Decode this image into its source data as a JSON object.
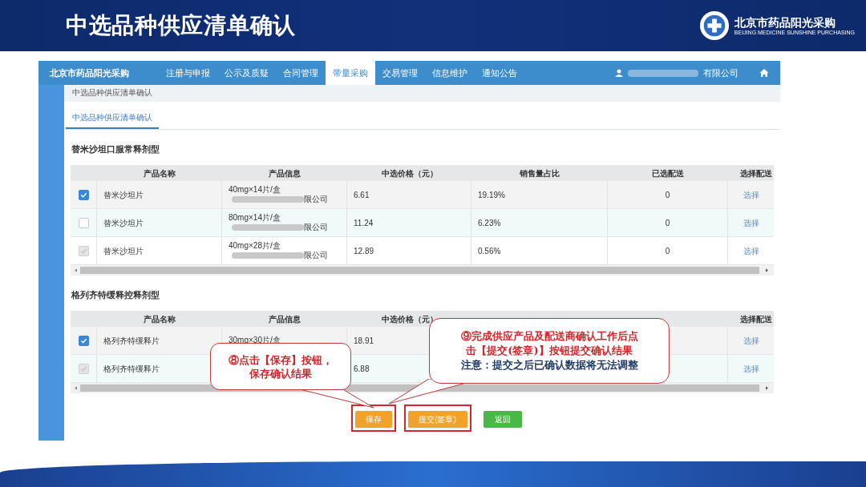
{
  "slide_title": "中选品种供应清单确认",
  "logo": {
    "name": "北京市药品阳光采购",
    "subtitle": "BEIJING MEDICINE SUNSHINE PURCHASING"
  },
  "app": {
    "brand": "北京市药品阳光采购",
    "nav": [
      {
        "label": "注册与申报",
        "selected": false
      },
      {
        "label": "公示及质疑",
        "selected": false
      },
      {
        "label": "合同管理",
        "selected": false
      },
      {
        "label": "带量采购",
        "selected": true
      },
      {
        "label": "交易管理",
        "selected": false
      },
      {
        "label": "信息维护",
        "selected": false
      },
      {
        "label": "通知公告",
        "selected": false
      }
    ],
    "user": "有限公司",
    "breadcrumb": "中选品种供应清单确认",
    "tabs": [
      {
        "label": "中选品种供应清单确认",
        "selected": true
      }
    ]
  },
  "sections": [
    {
      "title": "替米沙坦口服常释剂型",
      "headers": {
        "name": "产品名称",
        "info": "产品信息",
        "price": "中选价格（元）",
        "share": "销售量占比",
        "chosen": "已选配送",
        "select": "选择配送"
      },
      "rows": [
        {
          "checked": true,
          "disabled": false,
          "name": "替米沙坦片",
          "spec": "40mg×14片/盒",
          "company": "限公司",
          "price": "6.61",
          "share": "19.19%",
          "chosen": "0",
          "select": "选择"
        },
        {
          "checked": false,
          "disabled": false,
          "name": "替米沙坦片",
          "spec": "80mg×14片/盒",
          "company": "限公司",
          "price": "11.24",
          "share": "6.23%",
          "chosen": "0",
          "select": "选择"
        },
        {
          "checked": true,
          "disabled": true,
          "name": "替米沙坦片",
          "spec": "40mg×28片/盒",
          "company": "限公司",
          "price": "12.89",
          "share": "0.56%",
          "chosen": "0",
          "select": "选择"
        }
      ]
    },
    {
      "title": "格列齐特缓释控释剂型",
      "headers": {
        "name": "产品名称",
        "info": "产品信息",
        "price": "中选价格（元）",
        "select": "选择配送"
      },
      "rows": [
        {
          "checked": true,
          "disabled": false,
          "name": "格列齐特缓释片",
          "spec": "30mg×30片/盒",
          "price": "18.91",
          "select": "选择"
        },
        {
          "checked": true,
          "disabled": true,
          "name": "格列齐特缓释片",
          "price": "6.88",
          "select": "选择"
        }
      ]
    }
  ],
  "buttons": [
    {
      "label": "保存",
      "kind": "save",
      "highlighted": true
    },
    {
      "label": "提交(签章)",
      "kind": "submit",
      "highlighted": true
    },
    {
      "label": "返回",
      "kind": "back",
      "highlighted": false
    }
  ],
  "callouts": [
    {
      "lines": [
        "⑧点击【保存】按钮，",
        "保存确认结果"
      ]
    },
    {
      "lines": [
        "⑨完成供应产品及配送商确认工作后点",
        "击【提交(签章)】按钮提交确认结果"
      ],
      "note": "注意：提交之后已确认数据将无法调整"
    }
  ]
}
